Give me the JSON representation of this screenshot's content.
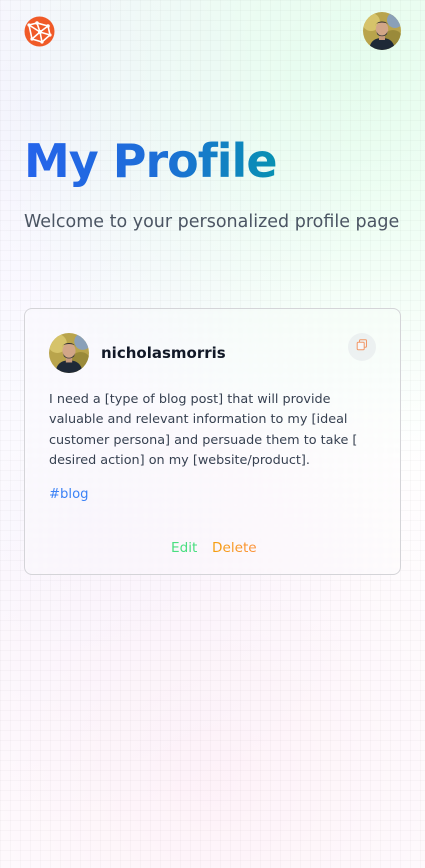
{
  "header": {
    "logo_icon": "globe-logo-icon",
    "logo_color": "#f05a28",
    "avatar_icon": "user-avatar"
  },
  "main": {
    "title": "My Profile",
    "description": "Welcome to your personalized profile page"
  },
  "posts": [
    {
      "username": "nicholasmorris",
      "prompt": "I need a [type of blog post] that will provide valuable and relevant information to my [ideal customer persona] and persuade them to take [ desired action] on my [website/product].",
      "tag": "#blog",
      "copy_icon": "copy-icon",
      "edit_label": "Edit",
      "delete_label": "Delete"
    }
  ],
  "colors": {
    "title_gradient_start": "#2563eb",
    "title_gradient_end": "#0891b2",
    "tag": "#3b82f6",
    "edit": "#4ade80",
    "delete": "#f59e0b",
    "copy_icon": "#f29766"
  }
}
